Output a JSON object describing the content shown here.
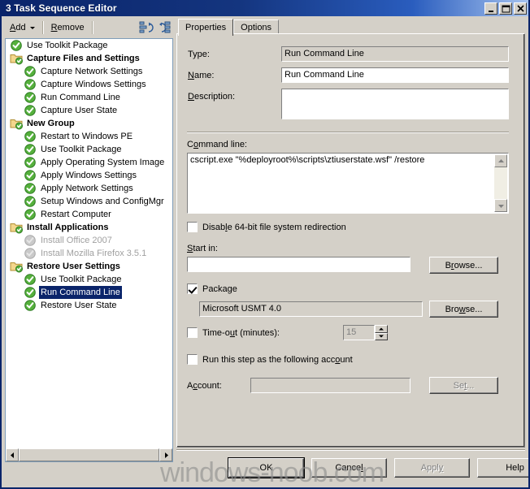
{
  "window": {
    "title": "3 Task Sequence Editor",
    "controls": [
      {
        "name": "minimize-button",
        "icon": "minimize-icon"
      },
      {
        "name": "maximize-button",
        "icon": "maximize-icon"
      },
      {
        "name": "close-button",
        "icon": "close-icon"
      }
    ]
  },
  "toolbar": {
    "add_label": "Add",
    "remove_label": "Remove",
    "icons": [
      {
        "name": "move-up-icon"
      },
      {
        "name": "move-down-icon"
      }
    ]
  },
  "tree": {
    "items": [
      {
        "label": "Use Toolkit Package",
        "type": "step",
        "indent": 0,
        "state": "enabled"
      },
      {
        "label": "Capture Files and Settings",
        "type": "group",
        "indent": 0,
        "state": "enabled"
      },
      {
        "label": "Capture Network Settings",
        "type": "step",
        "indent": 1,
        "state": "enabled"
      },
      {
        "label": "Capture Windows Settings",
        "type": "step",
        "indent": 1,
        "state": "enabled"
      },
      {
        "label": "Run Command Line",
        "type": "step",
        "indent": 1,
        "state": "enabled"
      },
      {
        "label": "Capture User State",
        "type": "step",
        "indent": 1,
        "state": "enabled"
      },
      {
        "label": "New Group",
        "type": "group",
        "indent": 0,
        "state": "enabled"
      },
      {
        "label": "Restart to Windows PE",
        "type": "step",
        "indent": 1,
        "state": "enabled"
      },
      {
        "label": "Use Toolkit Package",
        "type": "step",
        "indent": 1,
        "state": "enabled"
      },
      {
        "label": "Apply Operating System Image",
        "type": "step",
        "indent": 1,
        "state": "enabled"
      },
      {
        "label": "Apply Windows Settings",
        "type": "step",
        "indent": 1,
        "state": "enabled"
      },
      {
        "label": "Apply Network Settings",
        "type": "step",
        "indent": 1,
        "state": "enabled"
      },
      {
        "label": "Setup Windows and ConfigMgr",
        "type": "step",
        "indent": 1,
        "state": "enabled"
      },
      {
        "label": "Restart Computer",
        "type": "step",
        "indent": 1,
        "state": "enabled"
      },
      {
        "label": "Install Applications",
        "type": "group",
        "indent": 0,
        "state": "enabled"
      },
      {
        "label": "Install Office 2007",
        "type": "step",
        "indent": 1,
        "state": "disabled"
      },
      {
        "label": "Install Mozilla Firefox 3.5.1",
        "type": "step",
        "indent": 1,
        "state": "disabled"
      },
      {
        "label": "Restore User Settings",
        "type": "group",
        "indent": 0,
        "state": "enabled"
      },
      {
        "label": "Use Toolkit Package",
        "type": "step",
        "indent": 1,
        "state": "enabled"
      },
      {
        "label": "Run Command Line",
        "type": "step",
        "indent": 1,
        "state": "selected"
      },
      {
        "label": "Restore User State",
        "type": "step",
        "indent": 1,
        "state": "enabled"
      }
    ],
    "hscrollbar": {
      "left_arrow": "left-arrow-icon",
      "right_arrow": "right-arrow-icon"
    }
  },
  "tabs": [
    {
      "label": "Properties",
      "active": true
    },
    {
      "label": "Options",
      "active": false
    }
  ],
  "properties": {
    "type_label": "Type:",
    "type_value": "Run Command Line",
    "name_label": "Name:",
    "name_value": "Run Command Line",
    "description_label": "Description:",
    "description_value": "",
    "command_line_label": "Command line:",
    "command_line_value": "cscript.exe \"%deployroot%\\scripts\\ztiuserstate.wsf\" /restore",
    "disable_redirection_label": "Disable 64-bit file system redirection",
    "disable_redirection_checked": false,
    "start_in_label": "Start in:",
    "start_in_value": "",
    "start_in_browse_label": "Browse...",
    "package_label": "Package",
    "package_checked": true,
    "package_value": "Microsoft USMT 4.0",
    "package_browse_label": "Browse...",
    "timeout_label": "Time-out (minutes):",
    "timeout_checked": false,
    "timeout_value": "15",
    "run_as_label": "Run this step as the following account",
    "run_as_checked": false,
    "account_label": "Account:",
    "account_value": "",
    "set_label": "Set..."
  },
  "footer": {
    "ok_label": "OK",
    "cancel_label": "Cancel",
    "apply_label": "Apply",
    "apply_disabled": true,
    "help_label": "Help"
  },
  "watermark": "windows-noob.com",
  "colors": {
    "window_face": "#d4d0c8",
    "title_active": "#0a246a",
    "selection": "#0a246a",
    "field": "#ffffff",
    "disabled_text": "#a0a0a0",
    "check_green": "#3c9a3c",
    "folder_yellow": "#f5d98a"
  }
}
